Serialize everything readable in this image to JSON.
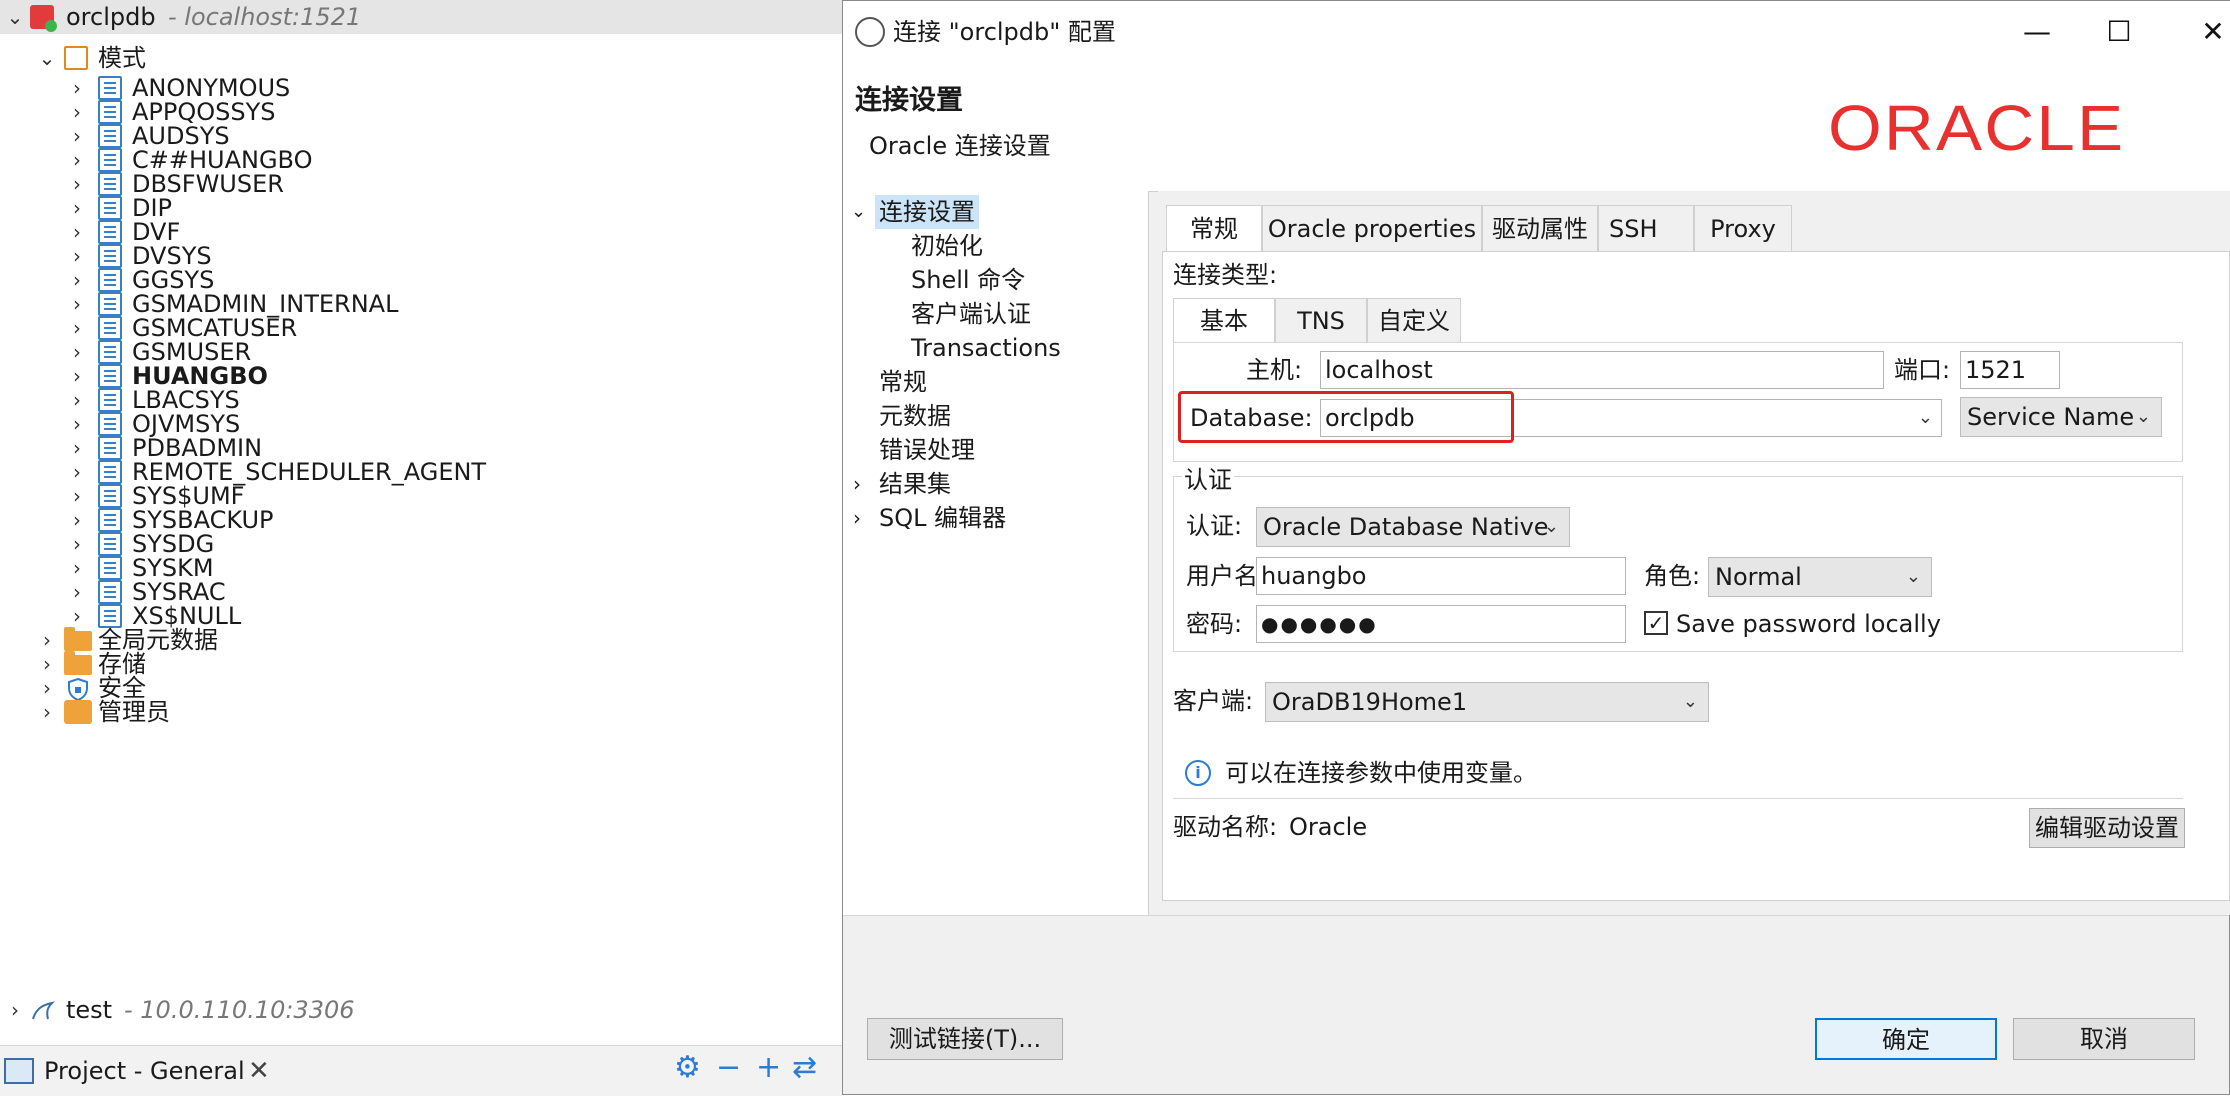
{
  "navigator": {
    "connections": [
      {
        "name": "orclpdb",
        "host": "- localhost:1521"
      },
      {
        "name": "test",
        "host": "- 10.0.110.10:3306"
      }
    ],
    "schemas_folder": "模式",
    "schemas": [
      "ANONYMOUS",
      "APPQOSSYS",
      "AUDSYS",
      "C##HUANGBO",
      "DBSFWUSER",
      "DIP",
      "DVF",
      "DVSYS",
      "GGSYS",
      "GSMADMIN_INTERNAL",
      "GSMCATUSER",
      "GSMUSER",
      "HUANGBO",
      "LBACSYS",
      "OJVMSYS",
      "PDBADMIN",
      "REMOTE_SCHEDULER_AGENT",
      "SYS$UMF",
      "SYSBACKUP",
      "SYSDG",
      "SYSKM",
      "SYSRAC",
      "XS$NULL"
    ],
    "bold_schema": "HUANGBO",
    "other_nodes": [
      "全局元数据",
      "存储",
      "安全",
      "管理员"
    ]
  },
  "bottom_panel": {
    "title": "Project - General"
  },
  "dialog": {
    "title": "连接 \"orclpdb\" 配置",
    "heading": "连接设置",
    "subheading": "Oracle 连接设置",
    "logo_text": "ORACLE",
    "menu": {
      "root": "连接设置",
      "children": [
        "初始化",
        "Shell 命令",
        "客户端认证",
        "Transactions"
      ],
      "others": [
        "常规",
        "元数据",
        "错误处理",
        "结果集",
        "SQL 编辑器"
      ]
    },
    "tabs": [
      "常规",
      "Oracle properties",
      "驱动属性",
      "SSH",
      "Proxy"
    ],
    "connection_type_label": "连接类型:",
    "subtabs": [
      "基本",
      "TNS",
      "自定义"
    ],
    "host_label": "主机:",
    "host_value": "localhost",
    "port_label": "端口:",
    "port_value": "1521",
    "database_label": "Database:",
    "database_value": "orclpdb",
    "service_type": "Service Name",
    "auth_group": "认证",
    "auth_label": "认证:",
    "auth_value": "Oracle Database Native",
    "user_label": "用户名:",
    "user_value": "huangbo",
    "role_label": "角色:",
    "role_value": "Normal",
    "password_label": "密码:",
    "password_value": "●●●●●●",
    "save_password_label": "Save password locally",
    "save_password_checked": true,
    "client_label": "客户端:",
    "client_value": "OraDB19Home1",
    "info_text": "可以在连接参数中使用变量。",
    "driver_label": "驱动名称:",
    "driver_value": "Oracle",
    "edit_driver_button": "编辑驱动设置",
    "test_button": "测试链接(T)...",
    "ok_button": "确定",
    "cancel_button": "取消"
  },
  "colors": {
    "oracle_red": "#e8312f",
    "accent_blue": "#0078d7",
    "highlight_red": "#e02020"
  }
}
